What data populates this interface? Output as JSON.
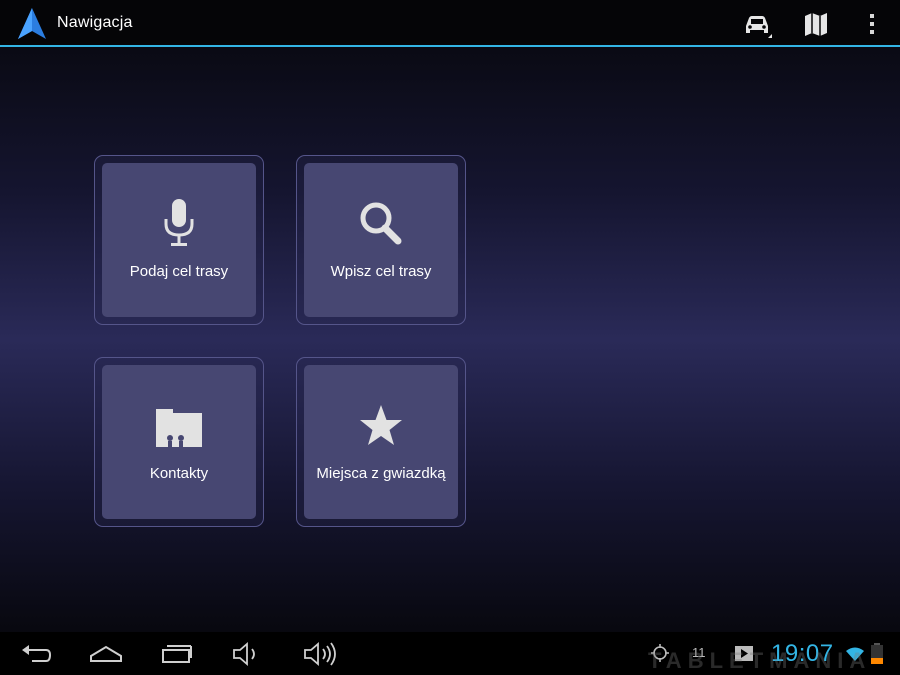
{
  "app": {
    "title": "Nawigacja",
    "accent_color": "#33b5e5",
    "icon": "navigation-arrow-icon"
  },
  "actionbar": {
    "actions": [
      {
        "name": "car-mode-icon"
      },
      {
        "name": "map-icon"
      },
      {
        "name": "overflow-menu-icon"
      }
    ]
  },
  "tiles": [
    {
      "label": "Podaj cel trasy",
      "icon": "microphone-icon"
    },
    {
      "label": "Wpisz cel trasy",
      "icon": "search-icon"
    },
    {
      "label": "Kontakty",
      "icon": "contacts-icon"
    },
    {
      "label": "Miejsca z gwiazdką",
      "icon": "star-icon"
    }
  ],
  "systembar": {
    "nav": [
      "back-icon",
      "home-icon",
      "recent-apps-icon",
      "volume-down-icon",
      "volume-up-icon"
    ],
    "notification_count": "11",
    "clock": "19:07",
    "status_icons": [
      "gps-icon",
      "media-icon",
      "wifi-icon",
      "battery-icon"
    ]
  },
  "watermark": {
    "text": "TABLETMANIA"
  }
}
